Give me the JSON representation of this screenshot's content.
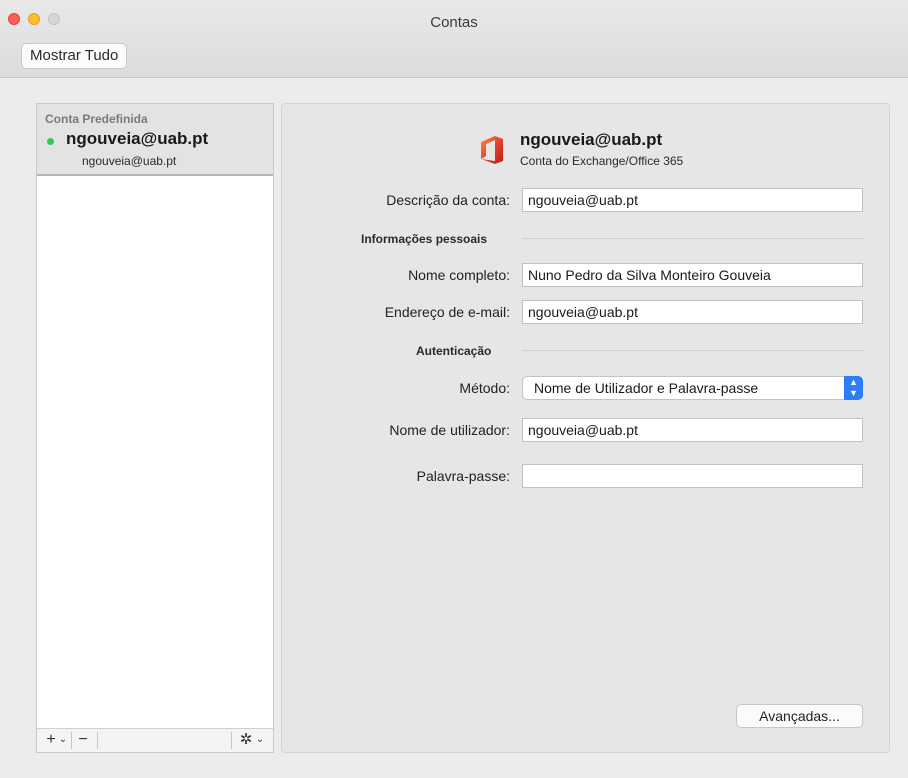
{
  "window": {
    "title": "Contas"
  },
  "toolbar": {
    "show_all_label": "Mostrar Tudo"
  },
  "sidebar": {
    "group_label": "Conta Predefinida",
    "selected_account": {
      "name": "ngouveia@uab.pt",
      "email": "ngouveia@uab.pt",
      "status_color": "#34c759"
    },
    "footer": {
      "add_label": "+",
      "remove_label": "−",
      "gear_icon": "gear-icon",
      "chevron": "⌄"
    }
  },
  "account": {
    "name": "ngouveia@uab.pt",
    "type": "Conta do Exchange/Office 365",
    "icon": "office-icon",
    "description_label": "Descrição da conta:",
    "description_value": "ngouveia@uab.pt"
  },
  "personal": {
    "section_label": "Informações pessoais",
    "full_name_label": "Nome completo:",
    "full_name_value": "Nuno Pedro da Silva Monteiro Gouveia",
    "email_label": "Endereço de e-mail:",
    "email_value": "ngouveia@uab.pt"
  },
  "auth": {
    "section_label": "Autenticação",
    "method_label": "Método:",
    "method_value": "Nome de Utilizador e Palavra-passe",
    "username_label": "Nome de utilizador:",
    "username_value": "ngouveia@uab.pt",
    "password_label": "Palavra-passe:",
    "password_value": ""
  },
  "actions": {
    "advanced_label": "Avançadas..."
  },
  "colors": {
    "accent": "#2f7df6",
    "office_red": "#e8412c"
  }
}
